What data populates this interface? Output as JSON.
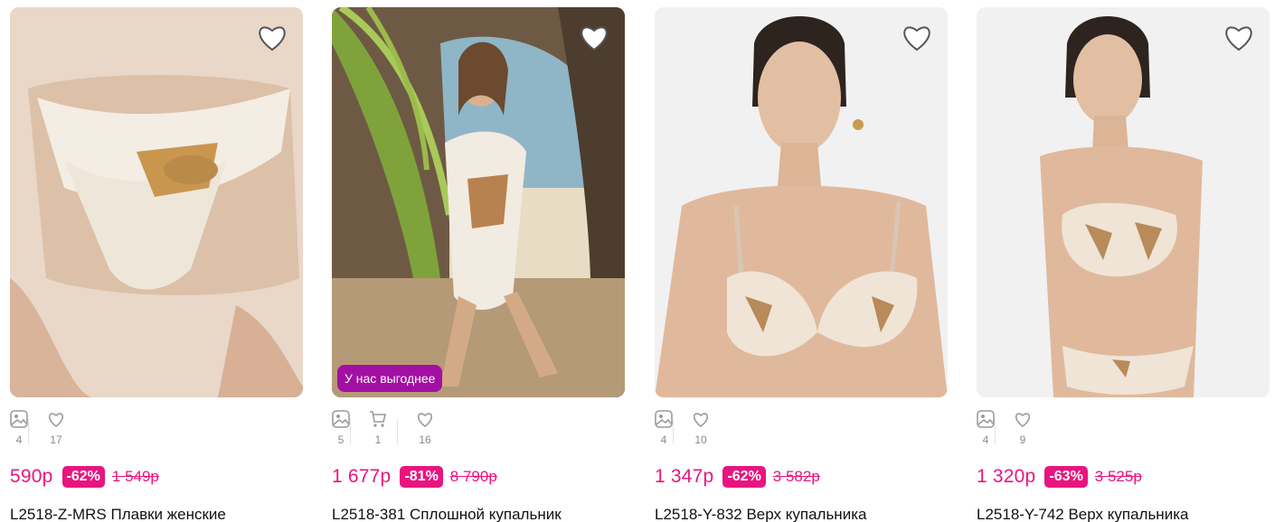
{
  "colors": {
    "accent": "#e8157f",
    "promo": "#a30fa3",
    "muted": "#8a8a8a"
  },
  "products": [
    {
      "favorite_icon": "heart-outline-icon",
      "stats": [
        {
          "icon": "image-icon",
          "count": "4"
        },
        {
          "icon": "heart-icon",
          "count": "17"
        }
      ],
      "price": "590р",
      "discount": "-62%",
      "old_price": "1 549р",
      "title": "L2518-Z-MRS Плавки женские"
    },
    {
      "favorite_icon": "heart-outline-icon",
      "promo_badge": "У нас выгоднее",
      "stats": [
        {
          "icon": "image-icon",
          "count": "5"
        },
        {
          "icon": "cart-icon",
          "count": "1"
        },
        {
          "icon": "heart-icon",
          "count": "16"
        }
      ],
      "price": "1 677р",
      "discount": "-81%",
      "old_price": "8 790р",
      "title": "L2518-381 Сплошной купальник"
    },
    {
      "favorite_icon": "heart-outline-icon",
      "stats": [
        {
          "icon": "image-icon",
          "count": "4"
        },
        {
          "icon": "heart-icon",
          "count": "10"
        }
      ],
      "price": "1 347р",
      "discount": "-62%",
      "old_price": "3 582р",
      "title": "L2518-Y-832 Верх купальника"
    },
    {
      "favorite_icon": "heart-outline-icon",
      "stats": [
        {
          "icon": "image-icon",
          "count": "4"
        },
        {
          "icon": "heart-icon",
          "count": "9"
        }
      ],
      "price": "1 320р",
      "discount": "-63%",
      "old_price": "3 525р",
      "title": "L2518-Y-742 Верх купальника"
    }
  ]
}
